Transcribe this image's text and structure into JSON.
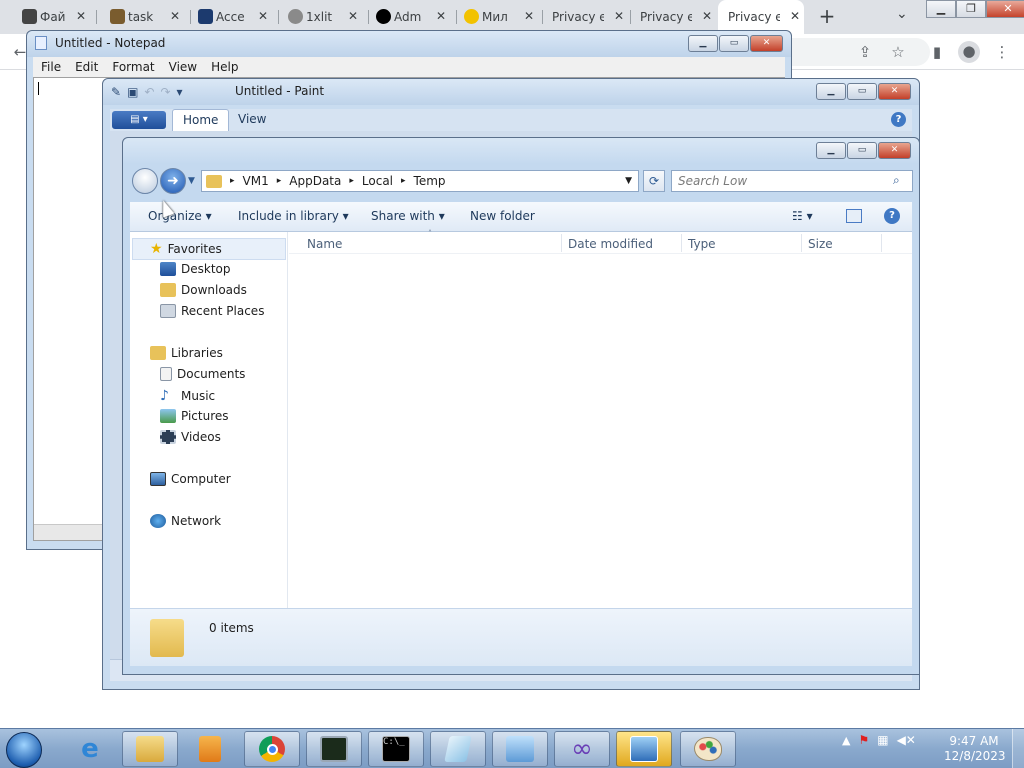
{
  "chrome": {
    "tabs": [
      {
        "label": "Фай",
        "favicon_color": "#444444"
      },
      {
        "label": "task",
        "favicon_color": "#7a5c2e"
      },
      {
        "label": "Acce",
        "favicon_color": "#1c3a6e"
      },
      {
        "label": "1xlit",
        "favicon_color": "#8a8a8a"
      },
      {
        "label": "Adm",
        "favicon_color": "#000000"
      },
      {
        "label": "Мил",
        "favicon_color": "#f2c200"
      },
      {
        "label": "Privacy e",
        "favicon_color": ""
      },
      {
        "label": "Privacy e",
        "favicon_color": ""
      },
      {
        "label": "Privacy e",
        "favicon_color": ""
      }
    ],
    "active_tab_index": 8,
    "new_tab_symbol": "+",
    "close_symbol": "✕"
  },
  "notepad": {
    "title": "Untitled - Notepad",
    "menu": [
      "File",
      "Edit",
      "Format",
      "View",
      "Help"
    ]
  },
  "paint": {
    "title": "Untitled - Paint",
    "tabs": [
      "Home",
      "View"
    ],
    "active_tab": "Home"
  },
  "explorer": {
    "breadcrumb": [
      "VM1",
      "AppData",
      "Local",
      "Temp"
    ],
    "search_placeholder": "Search Low",
    "commands": [
      "Organize",
      "Include in library",
      "Share with",
      "New folder"
    ],
    "columns": [
      "Name",
      "Date modified",
      "Type",
      "Size"
    ],
    "nav": {
      "favorites": {
        "label": "Favorites",
        "items": [
          "Desktop",
          "Downloads",
          "Recent Places"
        ]
      },
      "libraries": {
        "label": "Libraries",
        "items": [
          "Documents",
          "Music",
          "Pictures",
          "Videos"
        ]
      },
      "computer": "Computer",
      "network": "Network"
    },
    "item_count": "0 items"
  },
  "taskbar": {
    "clock_time": "9:47 AM",
    "clock_date": "12/8/2023"
  }
}
